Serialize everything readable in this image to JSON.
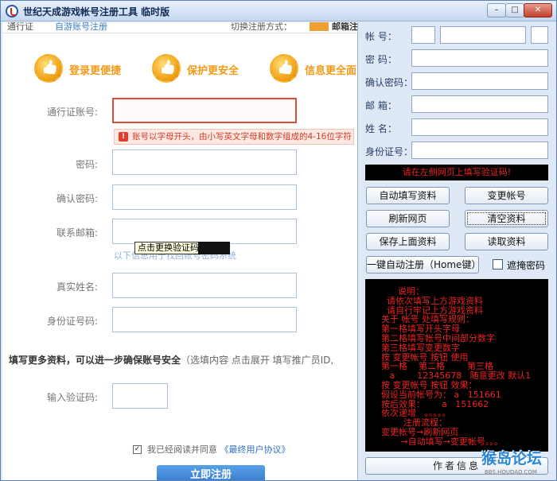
{
  "window": {
    "title": "世纪天成游戏帐号注册工具 临时版",
    "min": "–",
    "max": "□",
    "close": "✕"
  },
  "web": {
    "strip_left": "通行证",
    "strip_mid": "自游账号注册",
    "strip_right": "切换注册方式：",
    "strip_right2": "邮箱注",
    "features": [
      {
        "label": "登录更便捷"
      },
      {
        "label": "保护更安全"
      },
      {
        "label": "信息更全面"
      }
    ],
    "labels": {
      "account": "通行证账号:",
      "password": "密码:",
      "confirm": "确认密码:",
      "email": "联系邮箱:",
      "realname": "真实姓名:",
      "idcard": "身份证号码:",
      "captcha": "输入验证码:"
    },
    "error_icon": "!",
    "error_text": "账号以字母开头，由小写英文字母和数字组成的4-16位字符",
    "email_hint": "以下信息用于找回账号密码系统",
    "tooltip": "点击更换验证码",
    "more_info_bold": "填写更多资料，可以进一步确保账号安全",
    "more_info_rest": "（选填内容 点击展开  填写推广员ID,",
    "agree_check": "✓",
    "agree_text": "我已经阅读并同意",
    "agree_link": "《最终用户协议》",
    "register_btn": "立即注册"
  },
  "panel": {
    "labels": {
      "account": "帐    号：",
      "password": "密    码：",
      "confirm": "确认密码：",
      "email": "邮    箱：",
      "name": "姓    名：",
      "idcard": "身份证号："
    },
    "captcha_banner": "请在左侧网页上填写验证码!",
    "buttons": {
      "autofill": "自动填写资料",
      "change_account": "变更帐号",
      "refresh": "刷新网页",
      "clear": "清空资料",
      "save": "保存上面资料",
      "load": "读取资料",
      "one_click": "一键自动注册（Home键）",
      "author": "作者信息"
    },
    "hide_password": "遮掩密码",
    "instructions": [
      "      说明：",
      "  请依次填写上方游戏资料",
      "  请自行牢记上方游戏资料",
      "",
      "关于 帐号 处填写规则：",
      "第一格填写开头字母",
      "第二格填写帐号中间部分数字",
      "第三格填写变更数字",
      "按 变更帐号 按钮 使用",
      "第一格    第二格        第三格",
      "   a        12345678   随意更改 默认1",
      "按 变更帐号 按钮 效果：",
      "假设当前帐号为： a   151661",
      "按后效果：      a   151662",
      "依次递增   。。。。。",
      "        注册流程：",
      "变更帐号→刷新网页",
      "       →自动填写→变更帐号。。。"
    ]
  },
  "watermark": {
    "big": "猴岛论坛",
    "small": "BBS.HOUDAO.COM"
  }
}
